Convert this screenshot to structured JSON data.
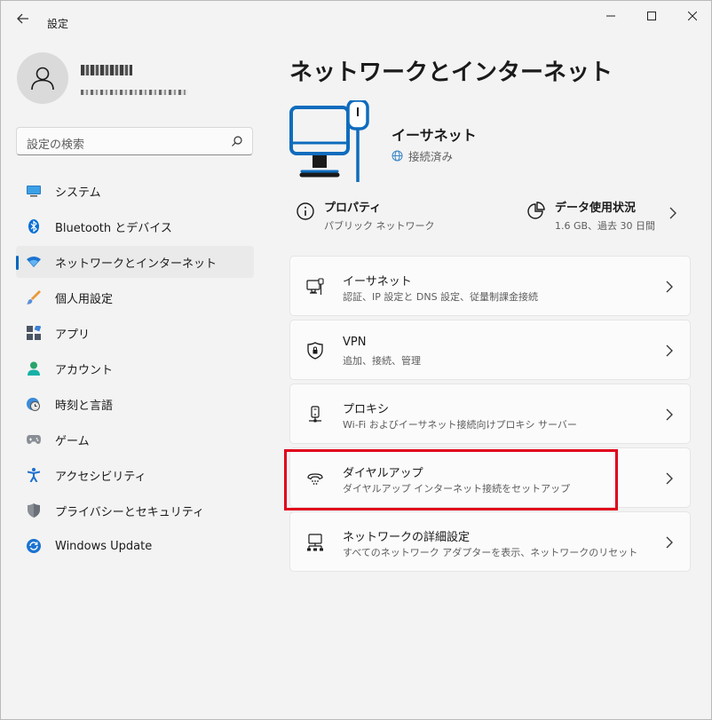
{
  "window": {
    "title": "設定"
  },
  "search": {
    "placeholder": "設定の検索"
  },
  "sidebar": {
    "items": [
      {
        "label": "システム",
        "icon": "system-icon",
        "selected": false
      },
      {
        "label": "Bluetooth とデバイス",
        "icon": "bluetooth-icon",
        "selected": false
      },
      {
        "label": "ネットワークとインターネット",
        "icon": "wifi-icon",
        "selected": true
      },
      {
        "label": "個人用設定",
        "icon": "brush-icon",
        "selected": false
      },
      {
        "label": "アプリ",
        "icon": "apps-icon",
        "selected": false
      },
      {
        "label": "アカウント",
        "icon": "account-icon",
        "selected": false
      },
      {
        "label": "時刻と言語",
        "icon": "time-language-icon",
        "selected": false
      },
      {
        "label": "ゲーム",
        "icon": "gamepad-icon",
        "selected": false
      },
      {
        "label": "アクセシビリティ",
        "icon": "accessibility-icon",
        "selected": false
      },
      {
        "label": "プライバシーとセキュリティ",
        "icon": "shield-icon",
        "selected": false
      },
      {
        "label": "Windows Update",
        "icon": "update-icon",
        "selected": false
      }
    ]
  },
  "main": {
    "title": "ネットワークとインターネット",
    "connection": {
      "name": "イーサネット",
      "status": "接続済み"
    },
    "properties": {
      "title": "プロパティ",
      "subtitle": "パブリック ネットワーク"
    },
    "data_usage": {
      "title": "データ使用状況",
      "subtitle": "1.6 GB、過去 30 日間"
    },
    "cards": [
      {
        "title": "イーサネット",
        "subtitle": "認証、IP 設定と DNS 設定、従量制課金接続",
        "icon": "ethernet-icon"
      },
      {
        "title": "VPN",
        "subtitle": "追加、接続、管理",
        "icon": "vpn-shield-icon"
      },
      {
        "title": "プロキシ",
        "subtitle": "Wi-Fi およびイーサネット接続向けプロキシ サーバー",
        "icon": "proxy-icon"
      },
      {
        "title": "ダイヤルアップ",
        "subtitle": "ダイヤルアップ インターネット接続をセットアップ",
        "icon": "dialup-icon"
      },
      {
        "title": "ネットワークの詳細設定",
        "subtitle": "すべてのネットワーク アダプターを表示、ネットワークのリセット",
        "icon": "advanced-network-icon"
      }
    ]
  },
  "colors": {
    "accent": "#0067c0",
    "highlight": "#e1001b"
  }
}
